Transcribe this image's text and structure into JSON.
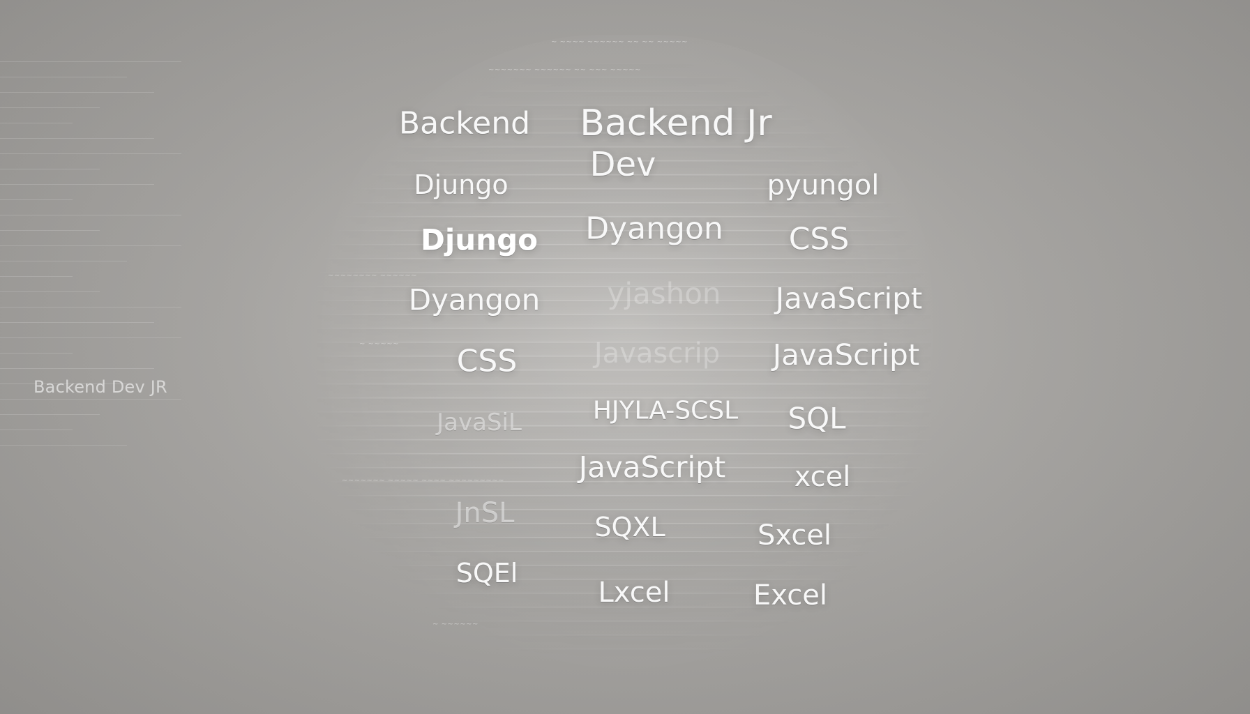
{
  "left_panel": {
    "label": "Backend Dev JR"
  },
  "center_grid": {
    "items": [
      {
        "text": "Backend",
        "tone": "normal",
        "size": 44
      },
      {
        "text": "Backend Jr",
        "tone": "normal",
        "size": 52
      },
      {
        "text": "Dev",
        "tone": "normal",
        "size": 48
      },
      {
        "text": "Djungo",
        "tone": "normal",
        "size": 38
      },
      {
        "text": "pyungol",
        "tone": "normal",
        "size": 40
      },
      {
        "text": "Djungo",
        "tone": "strong",
        "size": 42
      },
      {
        "text": "Dyangon",
        "tone": "normal",
        "size": 44
      },
      {
        "text": "CSS",
        "tone": "normal",
        "size": 44
      },
      {
        "text": "Dyangon",
        "tone": "normal",
        "size": 42
      },
      {
        "text": "yjashon",
        "tone": "ghost",
        "size": 42
      },
      {
        "text": "JavaScript",
        "tone": "normal",
        "size": 42
      },
      {
        "text": "CSS",
        "tone": "normal",
        "size": 44
      },
      {
        "text": "Javascrip",
        "tone": "ghost",
        "size": 40
      },
      {
        "text": "JavaScript",
        "tone": "normal",
        "size": 42
      },
      {
        "text": "JavaSiL",
        "tone": "dim",
        "size": 34
      },
      {
        "text": "HJYLA-SCSL",
        "tone": "normal",
        "size": 36
      },
      {
        "text": "SQL",
        "tone": "normal",
        "size": 42
      },
      {
        "text": "JavaScript",
        "tone": "normal",
        "size": 42
      },
      {
        "text": "xcel",
        "tone": "normal",
        "size": 40
      },
      {
        "text": "JnSL",
        "tone": "dim",
        "size": 40
      },
      {
        "text": "SQXL",
        "tone": "normal",
        "size": 38
      },
      {
        "text": "Sxcel",
        "tone": "normal",
        "size": 40
      },
      {
        "text": "SQEl",
        "tone": "normal",
        "size": 38
      },
      {
        "text": "Lxcel",
        "tone": "normal",
        "size": 40
      },
      {
        "text": "Excel",
        "tone": "normal",
        "size": 40
      }
    ]
  }
}
